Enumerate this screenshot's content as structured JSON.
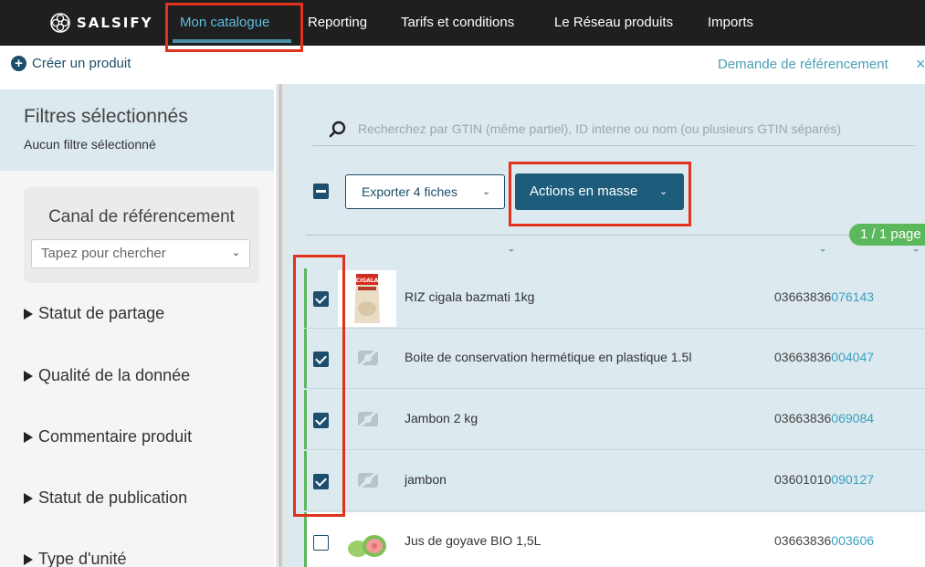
{
  "topbar": {
    "logo_text": "SALSIFY",
    "nav": [
      "Mon catalogue",
      "Reporting",
      "Tarifs et conditions",
      "Le Réseau produits",
      "Imports"
    ]
  },
  "subbar": {
    "create_label": "Créer un produit",
    "referencing_link": "Demande de référencement"
  },
  "sidebar": {
    "filters_title": "Filtres sélectionnés",
    "filters_empty": "Aucun filtre sélectionné",
    "canal_title": "Canal de référencement",
    "canal_placeholder": "Tapez pour chercher",
    "filters": [
      "Statut de partage",
      "Qualité de la donnée",
      "Commentaire produit",
      "Statut de publication",
      "Type d'unité"
    ]
  },
  "main": {
    "search_placeholder": "Recherchez par GTIN (même partiel), ID interne ou nom (ou plusieurs GTIN séparés)",
    "export_label": "Exporter 4 fiches",
    "mass_actions_label": "Actions en masse",
    "page_indicator": "1 / 1 page",
    "rows": [
      {
        "name": "RIZ cigala bazmati 1kg",
        "gtin_prefix": "03663836",
        "gtin_suffix": "076143",
        "checked": true,
        "image": "rice-bag"
      },
      {
        "name": "Boite de conservation hermétique en plastique 1.5l",
        "gtin_prefix": "03663836",
        "gtin_suffix": "004047",
        "checked": true,
        "image": "no-image"
      },
      {
        "name": "Jambon 2 kg",
        "gtin_prefix": "03663836",
        "gtin_suffix": "069084",
        "checked": true,
        "image": "no-image"
      },
      {
        "name": "jambon",
        "gtin_prefix": "03601010",
        "gtin_suffix": "090127",
        "checked": true,
        "image": "no-image"
      },
      {
        "name": "Jus de goyave BIO 1,5L",
        "gtin_prefix": "03663836",
        "gtin_suffix": "003606",
        "checked": false,
        "image": "guava"
      }
    ]
  },
  "colors": {
    "accent": "#1d4e6b",
    "link": "#3a9fc0",
    "annotation": "#e0321c",
    "success": "#5cb85c"
  }
}
